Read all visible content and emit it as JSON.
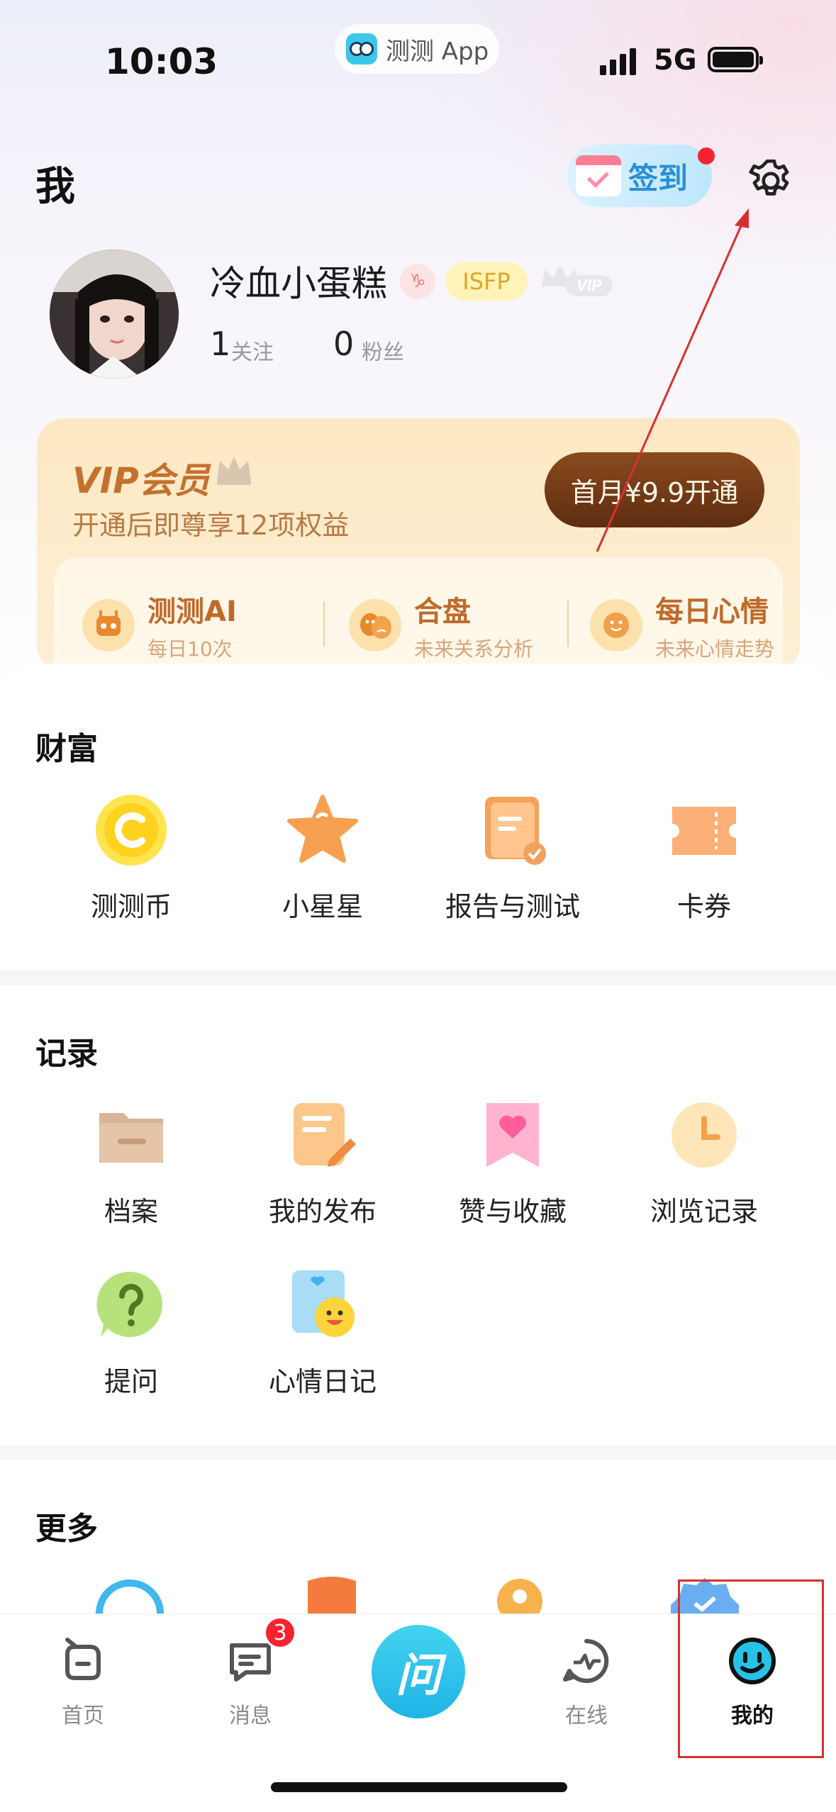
{
  "status_bar": {
    "time": "10:03",
    "app_pill": "测测 App",
    "network": "5G"
  },
  "header": {
    "title": "我",
    "checkin_label": "签到"
  },
  "profile": {
    "username": "冷血小蛋糕",
    "zodiac_badge": "♑",
    "mbti": "ISFP",
    "vip_badge": "VIP",
    "following_count": "1",
    "following_label": "关注",
    "followers_count": "0",
    "followers_label": "粉丝"
  },
  "vip": {
    "title": "VIP会员",
    "subtitle": "开通后即尊享12项权益",
    "button": "首月¥9.9开通",
    "perks": [
      {
        "name": "测测AI",
        "desc": "每日10次",
        "icon": "robot-icon"
      },
      {
        "name": "合盘",
        "desc": "未来关系分析",
        "icon": "masks-icon"
      },
      {
        "name": "每日心情",
        "desc": "未来心情走势",
        "icon": "smile-icon"
      }
    ]
  },
  "wealth": {
    "title": "财富",
    "items": [
      {
        "label": "测测币",
        "icon": "coin-icon"
      },
      {
        "label": "小星星",
        "icon": "star-icon"
      },
      {
        "label": "报告与测试",
        "icon": "report-icon"
      },
      {
        "label": "卡券",
        "icon": "ticket-icon"
      }
    ]
  },
  "records": {
    "title": "记录",
    "items": [
      {
        "label": "档案",
        "icon": "folder-icon"
      },
      {
        "label": "我的发布",
        "icon": "edit-note-icon"
      },
      {
        "label": "赞与收藏",
        "icon": "heart-bookmark-icon"
      },
      {
        "label": "浏览记录",
        "icon": "clock-icon"
      },
      {
        "label": "提问",
        "icon": "question-icon"
      },
      {
        "label": "心情日记",
        "icon": "mood-diary-icon"
      }
    ]
  },
  "more": {
    "title": "更多"
  },
  "tabbar": {
    "tabs": [
      {
        "label": "首页",
        "icon": "home-icon"
      },
      {
        "label": "消息",
        "icon": "message-icon"
      },
      {
        "label": "问",
        "icon": "ask-icon"
      },
      {
        "label": "在线",
        "icon": "online-icon"
      },
      {
        "label": "我的",
        "icon": "me-icon",
        "active": true
      }
    ],
    "message_badge": "3"
  },
  "colors": {
    "accent": "#1fb4e6",
    "vip_brown": "#5e2d10",
    "annotation": "#d9302e"
  }
}
